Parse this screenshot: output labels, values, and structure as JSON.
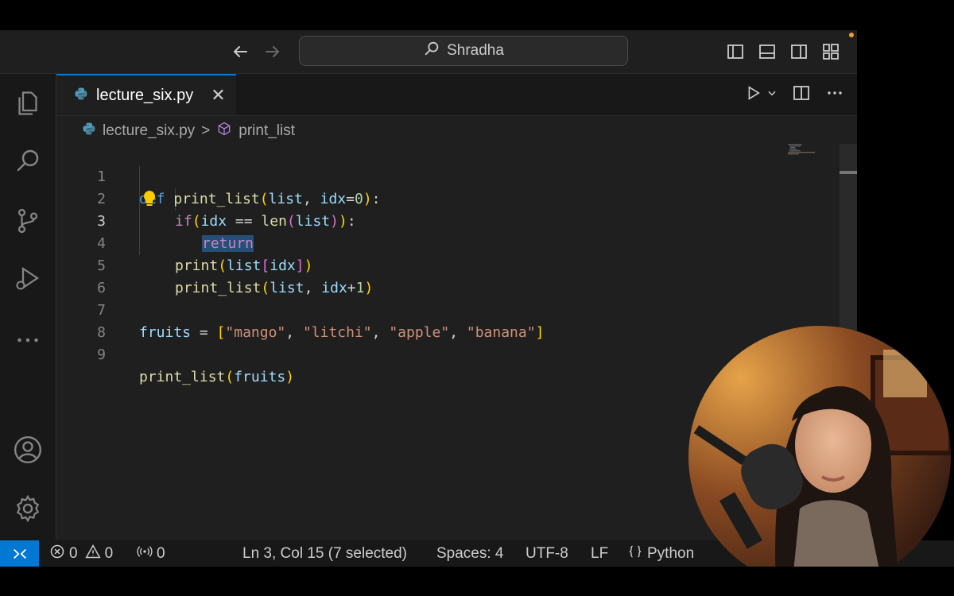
{
  "search": {
    "text": "Shradha"
  },
  "tab": {
    "label": "lecture_six.py",
    "close": "✕"
  },
  "breadcrumb": {
    "file": "lecture_six.py",
    "separator": ">",
    "symbol": "print_list"
  },
  "code": {
    "line_numbers": [
      "1",
      "2",
      "3",
      "4",
      "5",
      "6",
      "7",
      "8",
      "9"
    ],
    "active_line": "3",
    "l1": {
      "def": "def",
      "fn": "print_list",
      "p_open": "(",
      "a1": "list",
      "comma": ", ",
      "a2": "idx",
      "eq": "=",
      "num": "0",
      "p_close": ")",
      "colon": ":"
    },
    "l2": {
      "if": "if",
      "p_open": "(",
      "v1": "idx",
      "op": " == ",
      "fn": "len",
      "p2_open": "(",
      "v2": "list",
      "p2_close": ")",
      "p_close": ")",
      "colon": ":"
    },
    "l3": {
      "selected": "return"
    },
    "l4": {
      "fn": "print",
      "p_open": "(",
      "v": "list",
      "b_open": "[",
      "idx": "idx",
      "b_close": "]",
      "p_close": ")"
    },
    "l5": {
      "fn": "print_list",
      "p_open": "(",
      "a1": "list",
      "comma": ", ",
      "a2": "idx",
      "op": "+",
      "num": "1",
      "p_close": ")"
    },
    "l7": {
      "var": "fruits",
      "eq": " = ",
      "b_open": "[",
      "s1": "\"mango\"",
      "s2": "\"litchi\"",
      "s3": "\"apple\"",
      "s4": "\"banana\"",
      "sep": ", ",
      "b_close": "]"
    },
    "l9": {
      "fn": "print_list",
      "p_open": "(",
      "arg": "fruits",
      "p_close": ")"
    }
  },
  "status": {
    "errors": "0",
    "warnings": "0",
    "ports": "0",
    "cursor": "Ln 3, Col 15 (7 selected)",
    "spaces": "Spaces: 4",
    "encoding": "UTF-8",
    "eol": "LF",
    "language": "Python"
  },
  "colors": {
    "accent": "#0078d4",
    "keyword": "#569cd6",
    "function": "#dcdcaa",
    "variable": "#9cdcfe",
    "string": "#ce9178",
    "number": "#b5cea8",
    "selection": "#264f78",
    "notification_dot": "#f0a030"
  },
  "icons": [
    "back-arrow-icon",
    "forward-arrow-icon",
    "search-icon",
    "toggle-primary-sidebar-icon",
    "toggle-panel-icon",
    "toggle-secondary-sidebar-icon",
    "customize-layout-icon",
    "explorer-icon",
    "search-view-icon",
    "source-control-icon",
    "run-debug-icon",
    "more-icon",
    "account-icon",
    "settings-gear-icon",
    "python-file-icon",
    "run-icon",
    "chevron-down-icon",
    "split-editor-icon",
    "more-actions-icon",
    "symbol-method-icon",
    "lightbulb-icon",
    "remote-icon",
    "error-icon",
    "warning-icon",
    "ports-icon",
    "language-braces-icon"
  ]
}
